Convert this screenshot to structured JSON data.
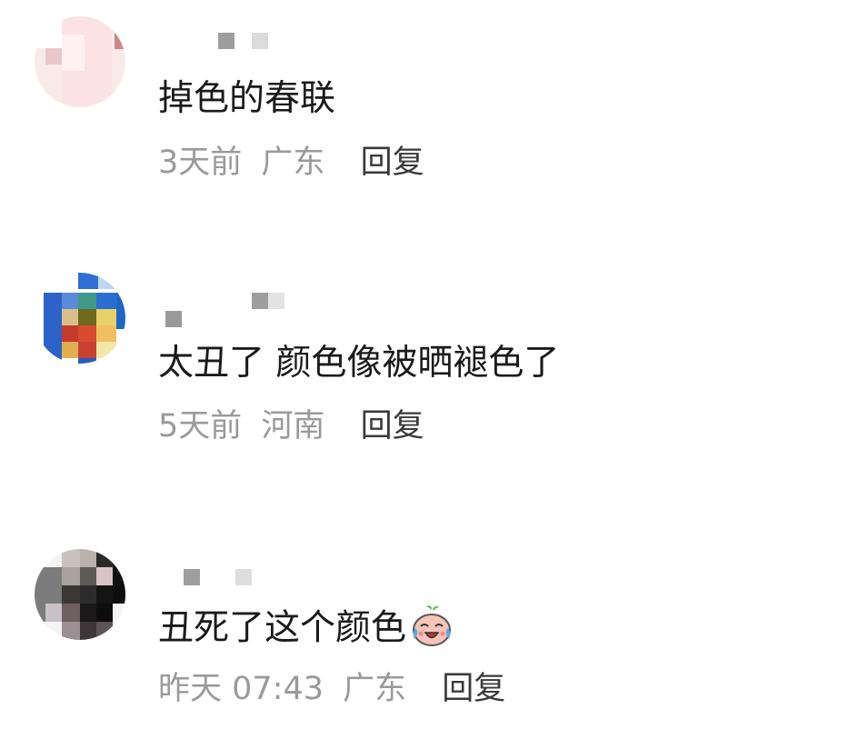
{
  "comments": [
    {
      "text": "掉色的春联",
      "time": "3天前",
      "location": "广东",
      "reply_label": "回复",
      "avatar_icon": "pixelated-avatar-icon"
    },
    {
      "text": "太丑了 颜色像被晒褪色了",
      "time": "5天前",
      "location": "河南",
      "reply_label": "回复",
      "avatar_icon": "pixelated-avatar-icon"
    },
    {
      "text": "丑死了这个颜色",
      "time": "昨天 07:43",
      "location": "广东",
      "reply_label": "回复",
      "avatar_icon": "pixelated-avatar-icon",
      "emoji_icon": "crying-laughing-emoji-icon"
    }
  ]
}
